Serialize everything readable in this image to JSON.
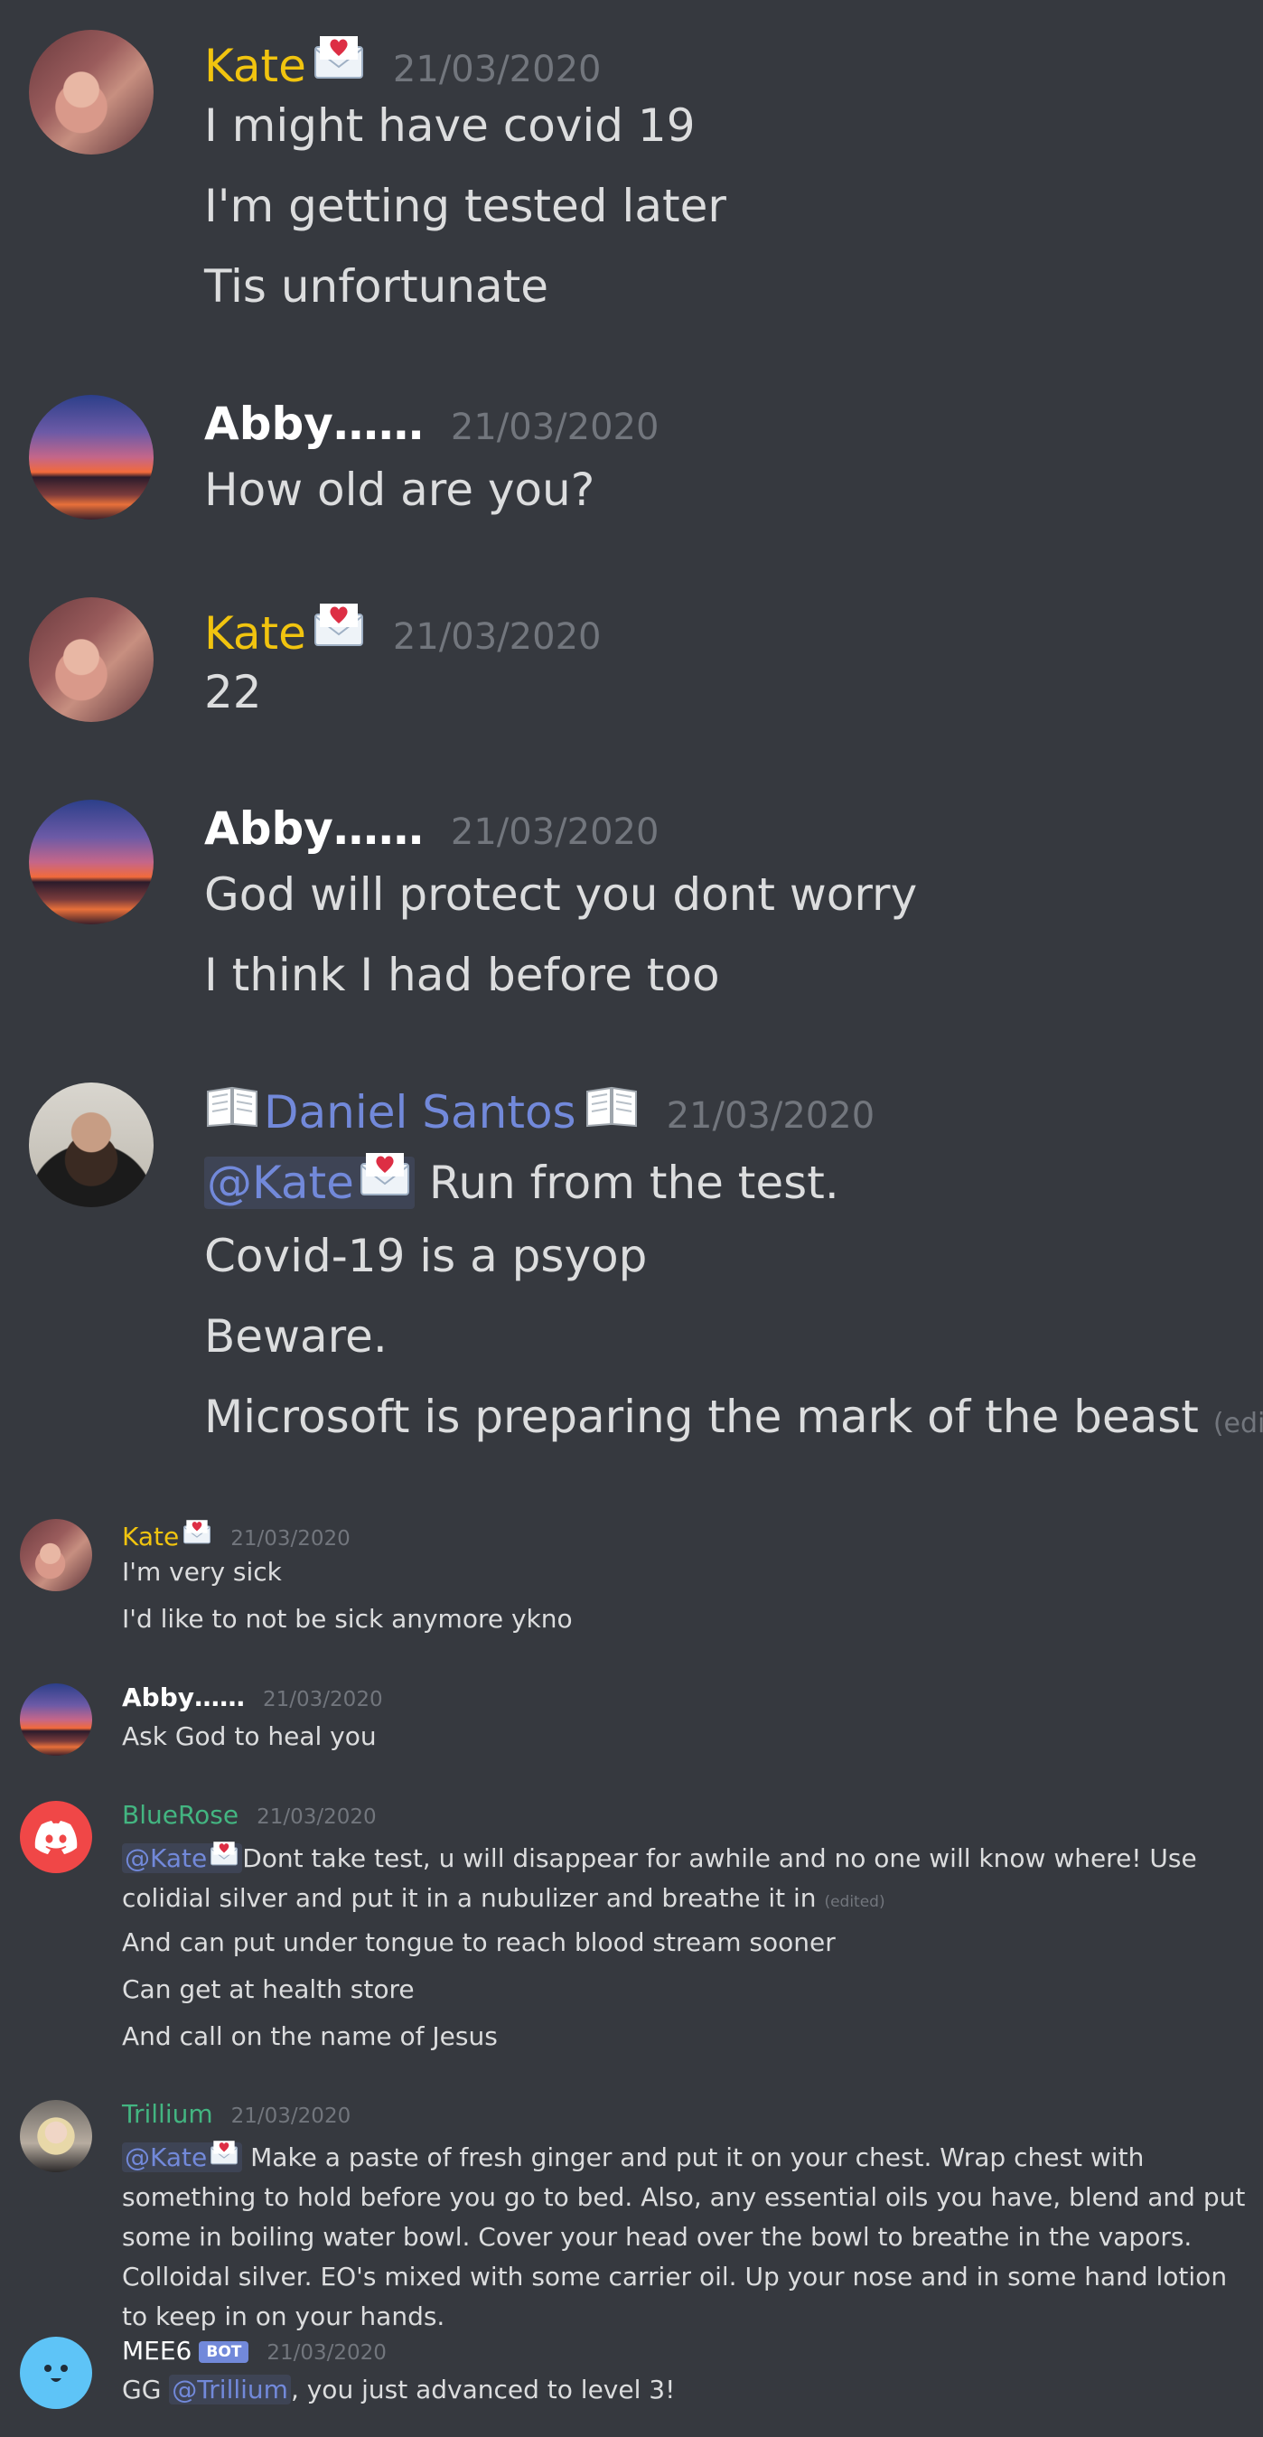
{
  "messages_large": [
    {
      "author": "Kate",
      "timestamp": "21/03/2020",
      "lines": [
        "I might have covid 19",
        "I'm getting tested later",
        "Tis unfortunate"
      ]
    },
    {
      "author": "Abby……",
      "timestamp": "21/03/2020",
      "lines": [
        "How old are you?"
      ]
    },
    {
      "author": "Kate",
      "timestamp": "21/03/2020",
      "lines": [
        "22"
      ]
    },
    {
      "author": "Abby……",
      "timestamp": "21/03/2020",
      "lines": [
        "God will protect  you dont worry",
        "I think I had before too"
      ]
    },
    {
      "author": "Daniel Santos",
      "timestamp": "21/03/2020",
      "mention": "@Kate",
      "lines": [
        "Run from the test.",
        "Covid-19 is a psyop",
        "Beware.",
        "Microsoft is preparing the mark of the beast"
      ],
      "edited": "(edited)"
    }
  ],
  "messages_small": [
    {
      "author": "Kate",
      "timestamp": "21/03/2020",
      "lines": [
        "I'm very sick",
        "I'd like to not be sick anymore ykno"
      ]
    },
    {
      "author": "Abby……",
      "timestamp": "21/03/2020",
      "lines": [
        "Ask God to heal you"
      ]
    },
    {
      "author": "BlueRose",
      "timestamp": "21/03/2020",
      "mention": "@Kate",
      "first": "Dont take test, u will disappear for awhile and no one will know where! Use colidial silver and put it in a nubulizer and breathe it in",
      "edited": "(edited)",
      "lines": [
        "And can put under tongue to reach blood stream sooner",
        "Can get at health store",
        "And call on the name of Jesus"
      ]
    },
    {
      "author": "Trillium",
      "timestamp": "21/03/2020",
      "mention": "@Kate",
      "text": "Make a paste of fresh ginger and put it on your chest. Wrap chest with something to hold before you go to bed. Also, any  essential oils you have, blend and put some in boiling water bowl. Cover your head over the bowl to breathe in the vapors. Colloidal silver. EO's mixed with some carrier oil. Up your nose and in some hand lotion to keep in on your hands."
    },
    {
      "author": "MEE6",
      "bot_tag": "BOT",
      "timestamp": "21/03/2020",
      "prefix": "GG ",
      "mention": "@Trillium",
      "suffix": ", you just advanced to level 3!"
    }
  ],
  "colors": {
    "background": "#36393f",
    "kate": "#f1c40f",
    "daniel": "#7289da",
    "green_role": "#43b581",
    "timestamp": "#72767d",
    "text": "#dcddde"
  },
  "icons": {
    "envelope": "love-letter-icon",
    "book": "open-book-icon",
    "discord": "discord-logo-icon"
  }
}
